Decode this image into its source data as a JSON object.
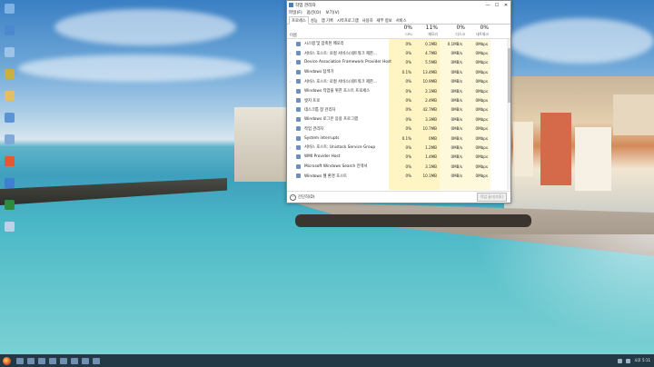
{
  "window": {
    "title": "작업 관리자",
    "controls": {
      "minimize": "—",
      "maximize": "☐",
      "close": "✕"
    }
  },
  "menu": [
    "파일(F)",
    "옵션(O)",
    "보기(V)"
  ],
  "tabs": [
    "프로세스",
    "성능",
    "앱 기록",
    "시작프로그램",
    "사용자",
    "세부 정보",
    "서비스"
  ],
  "active_tab": "프로세스",
  "columns": {
    "name": "이름",
    "cpu": {
      "pct": "0%",
      "label": "CPU"
    },
    "memory": {
      "pct": "11%",
      "label": "메모리"
    },
    "disk": {
      "pct": "0%",
      "label": "디스크"
    },
    "network": {
      "pct": "0%",
      "label": "네트워크"
    }
  },
  "processes": [
    {
      "expand": "",
      "name": "시스템 및 압축된 메모리",
      "cpu": "0%",
      "memory": "0.1MB",
      "disk": "0.1MB/s",
      "network": "0Mbps"
    },
    {
      "expand": "›",
      "name": "서비스 호스트: 로컬 서비스(네트워크 제한...",
      "cpu": "0%",
      "memory": "4.7MB",
      "disk": "0MB/s",
      "network": "0Mbps"
    },
    {
      "expand": "›",
      "name": "Device Association Framework Provider Host",
      "cpu": "0%",
      "memory": "5.5MB",
      "disk": "0MB/s",
      "network": "0Mbps"
    },
    {
      "expand": "",
      "name": "Windows 탐색기",
      "cpu": "0.1%",
      "memory": "13.4MB",
      "disk": "0MB/s",
      "network": "0Mbps"
    },
    {
      "expand": "›",
      "name": "서비스 호스트: 로컬 서비스(네트워크 제한...",
      "cpu": "0%",
      "memory": "10.9MB",
      "disk": "0MB/s",
      "network": "0Mbps"
    },
    {
      "expand": "",
      "name": "Windows 작업을 위한 호스트 프로세스",
      "cpu": "0%",
      "memory": "2.1MB",
      "disk": "0MB/s",
      "network": "0Mbps"
    },
    {
      "expand": "",
      "name": "엣지 프로",
      "cpu": "0%",
      "memory": "2.4MB",
      "disk": "0MB/s",
      "network": "0Mbps"
    },
    {
      "expand": "",
      "name": "데스크톱 창 관리자",
      "cpu": "0%",
      "memory": "42.7MB",
      "disk": "0MB/s",
      "network": "0Mbps"
    },
    {
      "expand": "",
      "name": "Windows 로그온 응용 프로그램",
      "cpu": "0%",
      "memory": "3.3MB",
      "disk": "0MB/s",
      "network": "0Mbps"
    },
    {
      "expand": "",
      "name": "작업 관리자",
      "cpu": "0%",
      "memory": "10.7MB",
      "disk": "0MB/s",
      "network": "0Mbps"
    },
    {
      "expand": "",
      "name": "System interrupts",
      "cpu": "0.1%",
      "memory": "0MB",
      "disk": "0MB/s",
      "network": "0Mbps"
    },
    {
      "expand": "›",
      "name": "서비스 호스트: Unistack Service Group",
      "cpu": "0%",
      "memory": "1.2MB",
      "disk": "0MB/s",
      "network": "0Mbps"
    },
    {
      "expand": "",
      "name": "WMI Provider Host",
      "cpu": "0%",
      "memory": "1.4MB",
      "disk": "0MB/s",
      "network": "0Mbps"
    },
    {
      "expand": "",
      "name": "Microsoft Windows Search 인덱서",
      "cpu": "0%",
      "memory": "3.1MB",
      "disk": "0MB/s",
      "network": "0Mbps"
    },
    {
      "expand": "",
      "name": "Windows 셸 환경 호스트",
      "cpu": "0%",
      "memory": "10.1MB",
      "disk": "0MB/s",
      "network": "0Mbps"
    }
  ],
  "footer": {
    "less": "간단히(D)",
    "end_task": "작업 끝내기(E)"
  },
  "taskbar": {
    "clock": "오후 5:11"
  },
  "colors": {
    "cpu_bg": "#fff4c4",
    "accent": "#2b6fc6"
  }
}
